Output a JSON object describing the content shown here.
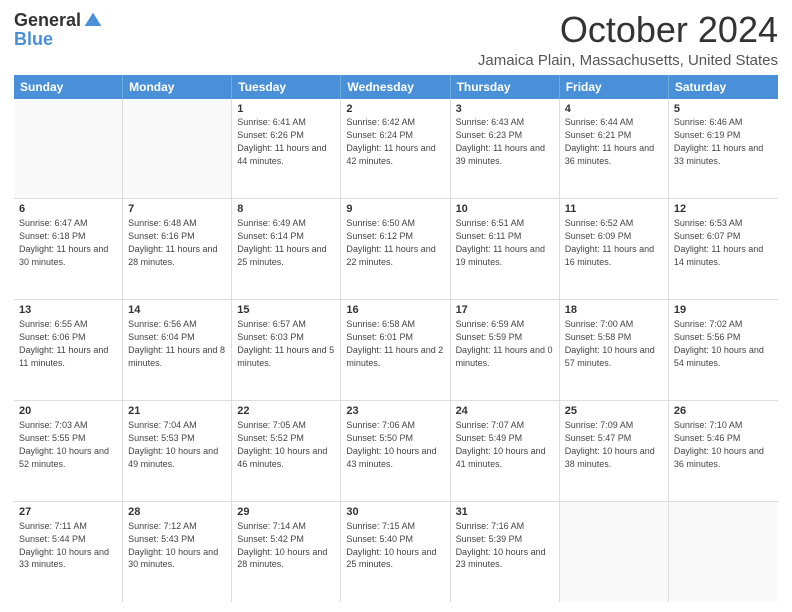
{
  "logo": {
    "general": "General",
    "blue": "Blue"
  },
  "title": "October 2024",
  "location": "Jamaica Plain, Massachusetts, United States",
  "days": [
    "Sunday",
    "Monday",
    "Tuesday",
    "Wednesday",
    "Thursday",
    "Friday",
    "Saturday"
  ],
  "rows": [
    [
      {
        "day": "",
        "content": ""
      },
      {
        "day": "",
        "content": ""
      },
      {
        "day": "1",
        "content": "Sunrise: 6:41 AM\nSunset: 6:26 PM\nDaylight: 11 hours and 44 minutes."
      },
      {
        "day": "2",
        "content": "Sunrise: 6:42 AM\nSunset: 6:24 PM\nDaylight: 11 hours and 42 minutes."
      },
      {
        "day": "3",
        "content": "Sunrise: 6:43 AM\nSunset: 6:23 PM\nDaylight: 11 hours and 39 minutes."
      },
      {
        "day": "4",
        "content": "Sunrise: 6:44 AM\nSunset: 6:21 PM\nDaylight: 11 hours and 36 minutes."
      },
      {
        "day": "5",
        "content": "Sunrise: 6:46 AM\nSunset: 6:19 PM\nDaylight: 11 hours and 33 minutes."
      }
    ],
    [
      {
        "day": "6",
        "content": "Sunrise: 6:47 AM\nSunset: 6:18 PM\nDaylight: 11 hours and 30 minutes."
      },
      {
        "day": "7",
        "content": "Sunrise: 6:48 AM\nSunset: 6:16 PM\nDaylight: 11 hours and 28 minutes."
      },
      {
        "day": "8",
        "content": "Sunrise: 6:49 AM\nSunset: 6:14 PM\nDaylight: 11 hours and 25 minutes."
      },
      {
        "day": "9",
        "content": "Sunrise: 6:50 AM\nSunset: 6:12 PM\nDaylight: 11 hours and 22 minutes."
      },
      {
        "day": "10",
        "content": "Sunrise: 6:51 AM\nSunset: 6:11 PM\nDaylight: 11 hours and 19 minutes."
      },
      {
        "day": "11",
        "content": "Sunrise: 6:52 AM\nSunset: 6:09 PM\nDaylight: 11 hours and 16 minutes."
      },
      {
        "day": "12",
        "content": "Sunrise: 6:53 AM\nSunset: 6:07 PM\nDaylight: 11 hours and 14 minutes."
      }
    ],
    [
      {
        "day": "13",
        "content": "Sunrise: 6:55 AM\nSunset: 6:06 PM\nDaylight: 11 hours and 11 minutes."
      },
      {
        "day": "14",
        "content": "Sunrise: 6:56 AM\nSunset: 6:04 PM\nDaylight: 11 hours and 8 minutes."
      },
      {
        "day": "15",
        "content": "Sunrise: 6:57 AM\nSunset: 6:03 PM\nDaylight: 11 hours and 5 minutes."
      },
      {
        "day": "16",
        "content": "Sunrise: 6:58 AM\nSunset: 6:01 PM\nDaylight: 11 hours and 2 minutes."
      },
      {
        "day": "17",
        "content": "Sunrise: 6:59 AM\nSunset: 5:59 PM\nDaylight: 11 hours and 0 minutes."
      },
      {
        "day": "18",
        "content": "Sunrise: 7:00 AM\nSunset: 5:58 PM\nDaylight: 10 hours and 57 minutes."
      },
      {
        "day": "19",
        "content": "Sunrise: 7:02 AM\nSunset: 5:56 PM\nDaylight: 10 hours and 54 minutes."
      }
    ],
    [
      {
        "day": "20",
        "content": "Sunrise: 7:03 AM\nSunset: 5:55 PM\nDaylight: 10 hours and 52 minutes."
      },
      {
        "day": "21",
        "content": "Sunrise: 7:04 AM\nSunset: 5:53 PM\nDaylight: 10 hours and 49 minutes."
      },
      {
        "day": "22",
        "content": "Sunrise: 7:05 AM\nSunset: 5:52 PM\nDaylight: 10 hours and 46 minutes."
      },
      {
        "day": "23",
        "content": "Sunrise: 7:06 AM\nSunset: 5:50 PM\nDaylight: 10 hours and 43 minutes."
      },
      {
        "day": "24",
        "content": "Sunrise: 7:07 AM\nSunset: 5:49 PM\nDaylight: 10 hours and 41 minutes."
      },
      {
        "day": "25",
        "content": "Sunrise: 7:09 AM\nSunset: 5:47 PM\nDaylight: 10 hours and 38 minutes."
      },
      {
        "day": "26",
        "content": "Sunrise: 7:10 AM\nSunset: 5:46 PM\nDaylight: 10 hours and 36 minutes."
      }
    ],
    [
      {
        "day": "27",
        "content": "Sunrise: 7:11 AM\nSunset: 5:44 PM\nDaylight: 10 hours and 33 minutes."
      },
      {
        "day": "28",
        "content": "Sunrise: 7:12 AM\nSunset: 5:43 PM\nDaylight: 10 hours and 30 minutes."
      },
      {
        "day": "29",
        "content": "Sunrise: 7:14 AM\nSunset: 5:42 PM\nDaylight: 10 hours and 28 minutes."
      },
      {
        "day": "30",
        "content": "Sunrise: 7:15 AM\nSunset: 5:40 PM\nDaylight: 10 hours and 25 minutes."
      },
      {
        "day": "31",
        "content": "Sunrise: 7:16 AM\nSunset: 5:39 PM\nDaylight: 10 hours and 23 minutes."
      },
      {
        "day": "",
        "content": ""
      },
      {
        "day": "",
        "content": ""
      }
    ]
  ]
}
